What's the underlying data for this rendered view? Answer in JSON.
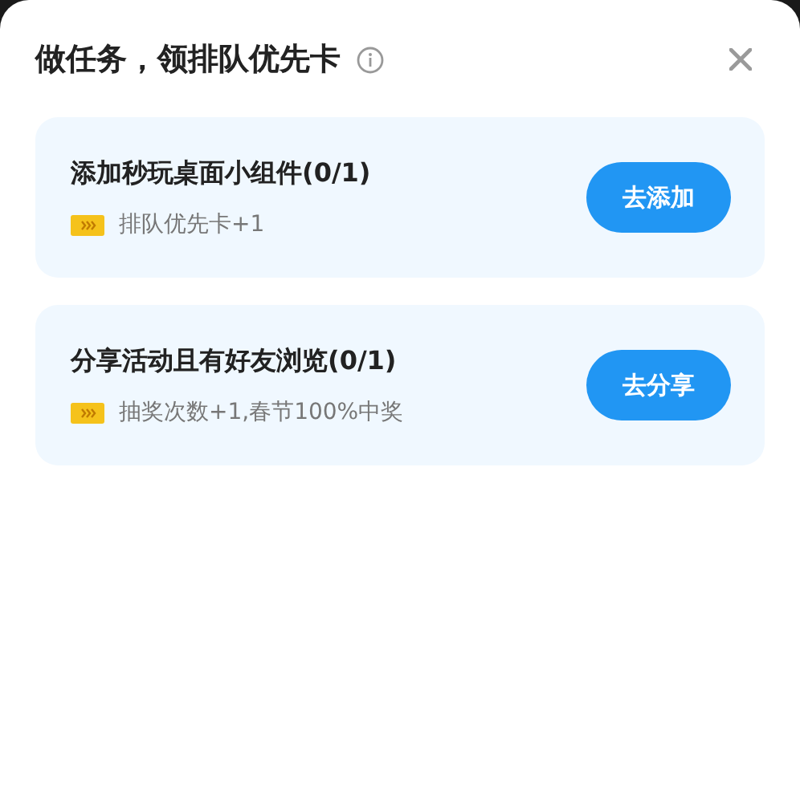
{
  "title": "做任务，领排队优先卡",
  "tasks": [
    {
      "name": "添加秒玩桌面小组件(0/1)",
      "reward": "排队优先卡+1",
      "action": "去添加"
    },
    {
      "name": "分享活动且有好友浏览(0/1)",
      "reward": "抽奖次数+1,春节100%中奖",
      "action": "去分享"
    }
  ]
}
